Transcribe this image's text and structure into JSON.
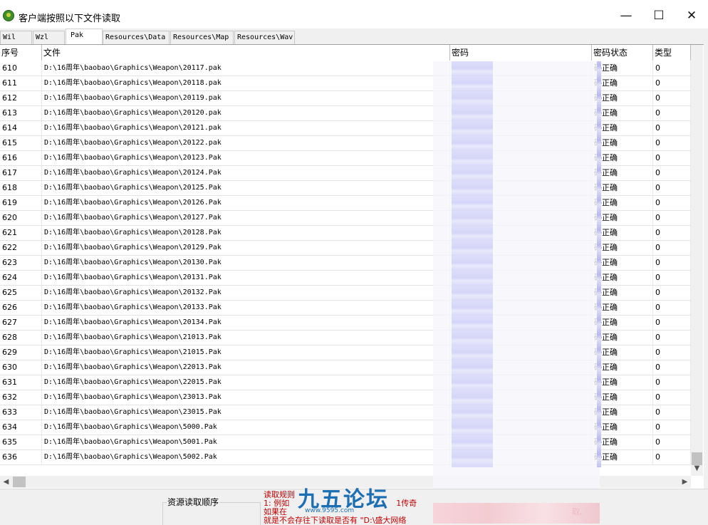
{
  "window": {
    "title": "客户端按照以下文件读取",
    "controls": [
      "—",
      "☐",
      "✕"
    ]
  },
  "tabs": [
    "Wil",
    "Wzl",
    "Pak",
    "Resources\\Data",
    "Resources\\Map",
    "Resources\\Wav"
  ],
  "active_tab": "Pak",
  "columns": [
    "序号",
    "文件",
    "密码",
    "密码状态",
    "类型"
  ],
  "rows": [
    {
      "no": "610",
      "file": "D:\\16周年\\baobao\\Graphics\\Weapon\\20117.pak",
      "status": "码正确",
      "type": "0"
    },
    {
      "no": "611",
      "file": "D:\\16周年\\baobao\\Graphics\\Weapon\\20118.pak",
      "status": "码正确",
      "type": "0"
    },
    {
      "no": "612",
      "file": "D:\\16周年\\baobao\\Graphics\\Weapon\\20119.pak",
      "status": "码正确",
      "type": "0"
    },
    {
      "no": "613",
      "file": "D:\\16周年\\baobao\\Graphics\\Weapon\\20120.pak",
      "status": "码正确",
      "type": "0"
    },
    {
      "no": "614",
      "file": "D:\\16周年\\baobao\\Graphics\\Weapon\\20121.pak",
      "status": "码正确",
      "type": "0"
    },
    {
      "no": "615",
      "file": "D:\\16周年\\baobao\\Graphics\\Weapon\\20122.pak",
      "status": "码正确",
      "type": "0"
    },
    {
      "no": "616",
      "file": "D:\\16周年\\baobao\\Graphics\\Weapon\\20123.Pak",
      "status": "码正确",
      "type": "0"
    },
    {
      "no": "617",
      "file": "D:\\16周年\\baobao\\Graphics\\Weapon\\20124.Pak",
      "status": "码正确",
      "type": "0"
    },
    {
      "no": "618",
      "file": "D:\\16周年\\baobao\\Graphics\\Weapon\\20125.Pak",
      "status": "码正确",
      "type": "0"
    },
    {
      "no": "619",
      "file": "D:\\16周年\\baobao\\Graphics\\Weapon\\20126.Pak",
      "status": "码正确",
      "type": "0"
    },
    {
      "no": "620",
      "file": "D:\\16周年\\baobao\\Graphics\\Weapon\\20127.Pak",
      "status": "码正确",
      "type": "0"
    },
    {
      "no": "621",
      "file": "D:\\16周年\\baobao\\Graphics\\Weapon\\20128.Pak",
      "status": "码正确",
      "type": "0"
    },
    {
      "no": "622",
      "file": "D:\\16周年\\baobao\\Graphics\\Weapon\\20129.Pak",
      "status": "码正确",
      "type": "0"
    },
    {
      "no": "623",
      "file": "D:\\16周年\\baobao\\Graphics\\Weapon\\20130.Pak",
      "status": "码正确",
      "type": "0"
    },
    {
      "no": "624",
      "file": "D:\\16周年\\baobao\\Graphics\\Weapon\\20131.Pak",
      "status": "码正确",
      "type": "0"
    },
    {
      "no": "625",
      "file": "D:\\16周年\\baobao\\Graphics\\Weapon\\20132.Pak",
      "status": "码正确",
      "type": "0"
    },
    {
      "no": "626",
      "file": "D:\\16周年\\baobao\\Graphics\\Weapon\\20133.Pak",
      "status": "码正确",
      "type": "0"
    },
    {
      "no": "627",
      "file": "D:\\16周年\\baobao\\Graphics\\Weapon\\20134.Pak",
      "status": "码正确",
      "type": "0"
    },
    {
      "no": "628",
      "file": "D:\\16周年\\baobao\\Graphics\\Weapon\\21013.Pak",
      "status": "码正确",
      "type": "0"
    },
    {
      "no": "629",
      "file": "D:\\16周年\\baobao\\Graphics\\Weapon\\21015.Pak",
      "status": "码正确",
      "type": "0"
    },
    {
      "no": "630",
      "file": "D:\\16周年\\baobao\\Graphics\\Weapon\\22013.Pak",
      "status": "码正确",
      "type": "0"
    },
    {
      "no": "631",
      "file": "D:\\16周年\\baobao\\Graphics\\Weapon\\22015.Pak",
      "status": "码正确",
      "type": "0"
    },
    {
      "no": "632",
      "file": "D:\\16周年\\baobao\\Graphics\\Weapon\\23013.Pak",
      "status": "码正确",
      "type": "0"
    },
    {
      "no": "633",
      "file": "D:\\16周年\\baobao\\Graphics\\Weapon\\23015.Pak",
      "status": "码正确",
      "type": "0"
    },
    {
      "no": "634",
      "file": "D:\\16周年\\baobao\\Graphics\\Weapon\\5000.Pak",
      "status": "码正确",
      "type": "0"
    },
    {
      "no": "635",
      "file": "D:\\16周年\\baobao\\Graphics\\Weapon\\5001.Pak",
      "status": "码正确",
      "type": "0"
    },
    {
      "no": "636",
      "file": "D:\\16周年\\baobao\\Graphics\\Weapon\\5002.Pak",
      "status": "码正确",
      "type": "0"
    }
  ],
  "bottom": {
    "group_label": "资源读取顺序",
    "rules_title": "读取规则",
    "rules_line1": "1: 例如",
    "rules_line1_end": "1传奇",
    "rules_line2": "如果在",
    "rules_line2_end": "取,",
    "rules_line3": "就是不会存往下读取是否有 \"D:\\盛大网络"
  },
  "watermark": {
    "text": "九五论坛",
    "sub": "www.9595.com"
  },
  "colors": {
    "rules_text": "#c00000",
    "watermark": "#1d6fb3",
    "redaction": "#cfcff7"
  },
  "icons": [
    "app-icon",
    "minimize-icon",
    "maximize-icon",
    "close-icon",
    "scroll-up-icon",
    "scroll-down-icon",
    "scroll-left-icon",
    "scroll-right-icon"
  ]
}
